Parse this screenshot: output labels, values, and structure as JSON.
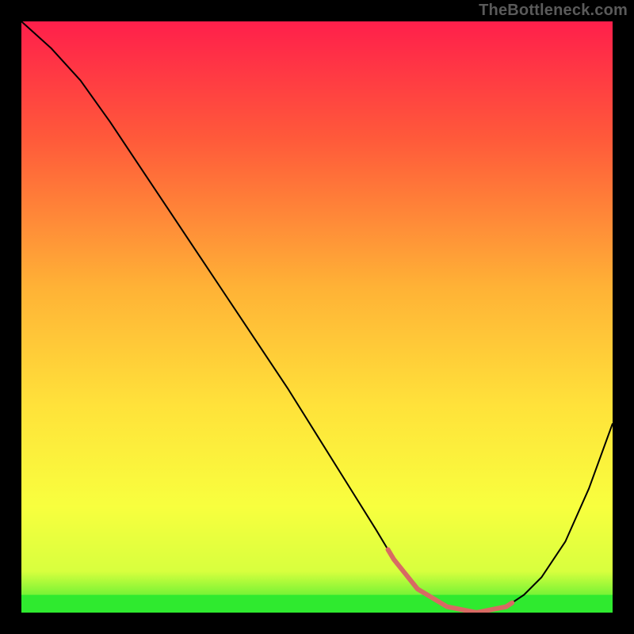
{
  "watermark": "TheBottleneck.com",
  "chart_data": {
    "type": "line",
    "title": "",
    "xlabel": "",
    "ylabel": "",
    "xlim": [
      0,
      100
    ],
    "ylim": [
      0,
      100
    ],
    "grid": false,
    "legend": false,
    "series": [
      {
        "name": "curve",
        "x": [
          0,
          5,
          10,
          15,
          20,
          25,
          30,
          35,
          40,
          45,
          50,
          55,
          60,
          63,
          67,
          72,
          77,
          82,
          85,
          88,
          92,
          96,
          100
        ],
        "y": [
          100,
          95.5,
          90,
          83,
          75.5,
          68,
          60.5,
          53,
          45.5,
          38,
          30,
          22,
          14,
          9,
          4,
          1,
          0,
          1,
          3,
          6,
          12,
          21,
          32
        ]
      }
    ],
    "highlight_range_x": [
      62,
      83
    ],
    "optimal_band_y": [
      0,
      3
    ],
    "gradient_stops": [
      {
        "offset": 0,
        "color": "#ff1f4b"
      },
      {
        "offset": 20,
        "color": "#ff5a3a"
      },
      {
        "offset": 45,
        "color": "#ffb236"
      },
      {
        "offset": 65,
        "color": "#ffe23a"
      },
      {
        "offset": 82,
        "color": "#f8ff3e"
      },
      {
        "offset": 93,
        "color": "#d8ff3e"
      },
      {
        "offset": 100,
        "color": "#2fea2f"
      }
    ]
  }
}
